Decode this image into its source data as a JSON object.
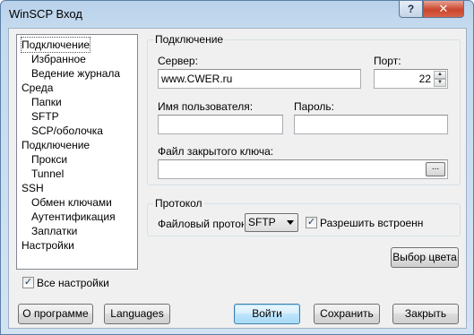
{
  "window": {
    "title": "WinSCP Вход",
    "help_label": "?",
    "close_label": "✕"
  },
  "tree": {
    "items": [
      {
        "label": "Подключение",
        "level": 0,
        "selected": true
      },
      {
        "label": "Избранное",
        "level": 1
      },
      {
        "label": "Ведение журнала",
        "level": 1
      },
      {
        "label": "Среда",
        "level": 0
      },
      {
        "label": "Папки",
        "level": 1
      },
      {
        "label": "SFTP",
        "level": 1
      },
      {
        "label": "SCP/оболочка",
        "level": 1
      },
      {
        "label": "Подключение",
        "level": 0
      },
      {
        "label": "Прокси",
        "level": 1
      },
      {
        "label": "Tunnel",
        "level": 1
      },
      {
        "label": "SSH",
        "level": 0
      },
      {
        "label": "Обмен ключами",
        "level": 1
      },
      {
        "label": "Аутентификация",
        "level": 1
      },
      {
        "label": "Заплатки",
        "level": 1
      },
      {
        "label": "Настройки",
        "level": 0
      }
    ]
  },
  "connection": {
    "group_title": "Подключение",
    "server_label": "Сервер:",
    "server_value": "www.CWER.ru",
    "port_label": "Порт:",
    "port_value": "22",
    "username_label": "Имя пользователя:",
    "username_value": "",
    "password_label": "Пароль:",
    "password_value": "",
    "keyfile_label": "Файл закрытого ключа:",
    "keyfile_value": "",
    "browse_label": "..."
  },
  "protocol": {
    "group_title": "Протокол",
    "file_protocol_label": "Файловый протокол:",
    "file_protocol_value": "SFTP",
    "allow_fallback_label": "Разрешить встроенн",
    "allow_fallback_checked": true
  },
  "color_button": "Выбор цвета",
  "advanced": {
    "label": "Все настройки",
    "checked": true
  },
  "buttons": {
    "about": "О программе",
    "languages": "Languages",
    "login": "Войти",
    "save": "Сохранить",
    "close": "Закрыть"
  }
}
